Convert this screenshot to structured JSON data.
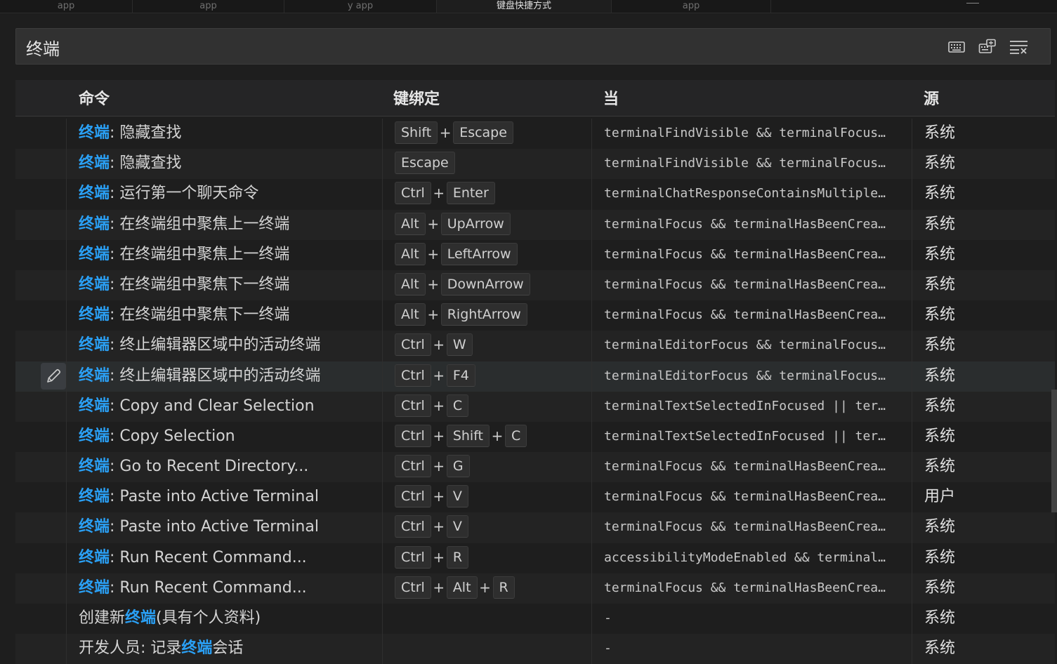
{
  "tabs": [
    {
      "label": "app"
    },
    {
      "label": "app"
    },
    {
      "label": "y app"
    },
    {
      "label": "键盘快捷方式"
    },
    {
      "label": "app"
    }
  ],
  "search": {
    "value": "终端",
    "placeholder": "",
    "icons": [
      "keyboard-icon",
      "sort-by-precedence-icon",
      "clear-search-icon"
    ]
  },
  "columns": {
    "command": "命令",
    "keybinding": "键绑定",
    "when": "当",
    "source": "源"
  },
  "highlight_term": "终端",
  "rows": [
    {
      "cmd_pre": "",
      "cmd_hl": "终端",
      "cmd_post": ": 隐藏查找",
      "keys": [
        "Shift",
        "Escape"
      ],
      "when": "terminalFindVisible && terminalFocus…",
      "source": "系统"
    },
    {
      "cmd_pre": "",
      "cmd_hl": "终端",
      "cmd_post": ": 隐藏查找",
      "keys": [
        "Escape"
      ],
      "when": "terminalFindVisible && terminalFocus…",
      "source": "系统"
    },
    {
      "cmd_pre": "",
      "cmd_hl": "终端",
      "cmd_post": ": 运行第一个聊天命令",
      "keys": [
        "Ctrl",
        "Enter"
      ],
      "when": "terminalChatResponseContainsMultiple…",
      "source": "系统"
    },
    {
      "cmd_pre": "",
      "cmd_hl": "终端",
      "cmd_post": ": 在终端组中聚焦上一终端",
      "keys": [
        "Alt",
        "UpArrow"
      ],
      "when": "terminalFocus && terminalHasBeenCrea…",
      "source": "系统"
    },
    {
      "cmd_pre": "",
      "cmd_hl": "终端",
      "cmd_post": ": 在终端组中聚焦上一终端",
      "keys": [
        "Alt",
        "LeftArrow"
      ],
      "when": "terminalFocus && terminalHasBeenCrea…",
      "source": "系统"
    },
    {
      "cmd_pre": "",
      "cmd_hl": "终端",
      "cmd_post": ": 在终端组中聚焦下一终端",
      "keys": [
        "Alt",
        "DownArrow"
      ],
      "when": "terminalFocus && terminalHasBeenCrea…",
      "source": "系统"
    },
    {
      "cmd_pre": "",
      "cmd_hl": "终端",
      "cmd_post": ": 在终端组中聚焦下一终端",
      "keys": [
        "Alt",
        "RightArrow"
      ],
      "when": "terminalFocus && terminalHasBeenCrea…",
      "source": "系统"
    },
    {
      "cmd_pre": "",
      "cmd_hl": "终端",
      "cmd_post": ": 终止编辑器区域中的活动终端",
      "keys": [
        "Ctrl",
        "W"
      ],
      "when": "terminalEditorFocus && terminalFocus…",
      "source": "系统"
    },
    {
      "cmd_pre": "",
      "cmd_hl": "终端",
      "cmd_post": ": 终止编辑器区域中的活动终端",
      "keys": [
        "Ctrl",
        "F4"
      ],
      "when": "terminalEditorFocus && terminalFocus…",
      "source": "系统",
      "focused": true
    },
    {
      "cmd_pre": "",
      "cmd_hl": "终端",
      "cmd_post": ": Copy and Clear Selection",
      "keys": [
        "Ctrl",
        "C"
      ],
      "when": "terminalTextSelectedInFocused || ter…",
      "source": "系统"
    },
    {
      "cmd_pre": "",
      "cmd_hl": "终端",
      "cmd_post": ": Copy Selection",
      "keys": [
        "Ctrl",
        "Shift",
        "C"
      ],
      "when": "terminalTextSelectedInFocused || ter…",
      "source": "系统"
    },
    {
      "cmd_pre": "",
      "cmd_hl": "终端",
      "cmd_post": ": Go to Recent Directory...",
      "keys": [
        "Ctrl",
        "G"
      ],
      "when": "terminalFocus && terminalHasBeenCrea…",
      "source": "系统"
    },
    {
      "cmd_pre": "",
      "cmd_hl": "终端",
      "cmd_post": ": Paste into Active Terminal",
      "keys": [
        "Ctrl",
        "V"
      ],
      "when": "terminalFocus && terminalHasBeenCrea…",
      "source": "用户"
    },
    {
      "cmd_pre": "",
      "cmd_hl": "终端",
      "cmd_post": ": Paste into Active Terminal",
      "keys": [
        "Ctrl",
        "V"
      ],
      "when": "terminalFocus && terminalHasBeenCrea…",
      "source": "系统"
    },
    {
      "cmd_pre": "",
      "cmd_hl": "终端",
      "cmd_post": ": Run Recent Command...",
      "keys": [
        "Ctrl",
        "R"
      ],
      "when": "accessibilityModeEnabled && terminal…",
      "source": "系统"
    },
    {
      "cmd_pre": "",
      "cmd_hl": "终端",
      "cmd_post": ": Run Recent Command...",
      "keys": [
        "Ctrl",
        "Alt",
        "R"
      ],
      "when": "terminalFocus && terminalHasBeenCrea…",
      "source": "系统"
    },
    {
      "cmd_pre": "创建新",
      "cmd_hl": "终端",
      "cmd_post": "(具有个人资料)",
      "keys": [],
      "when": "-",
      "source": "系统"
    },
    {
      "cmd_pre": "开发人员: 记录",
      "cmd_hl": "终端",
      "cmd_post": "会话",
      "keys": [],
      "when": "-",
      "source": "系统"
    }
  ],
  "colors": {
    "background": "#1e1e1e",
    "highlight": "#2aa0f5",
    "focused_row": "#2a2d2e",
    "alt_row": "#232323"
  }
}
